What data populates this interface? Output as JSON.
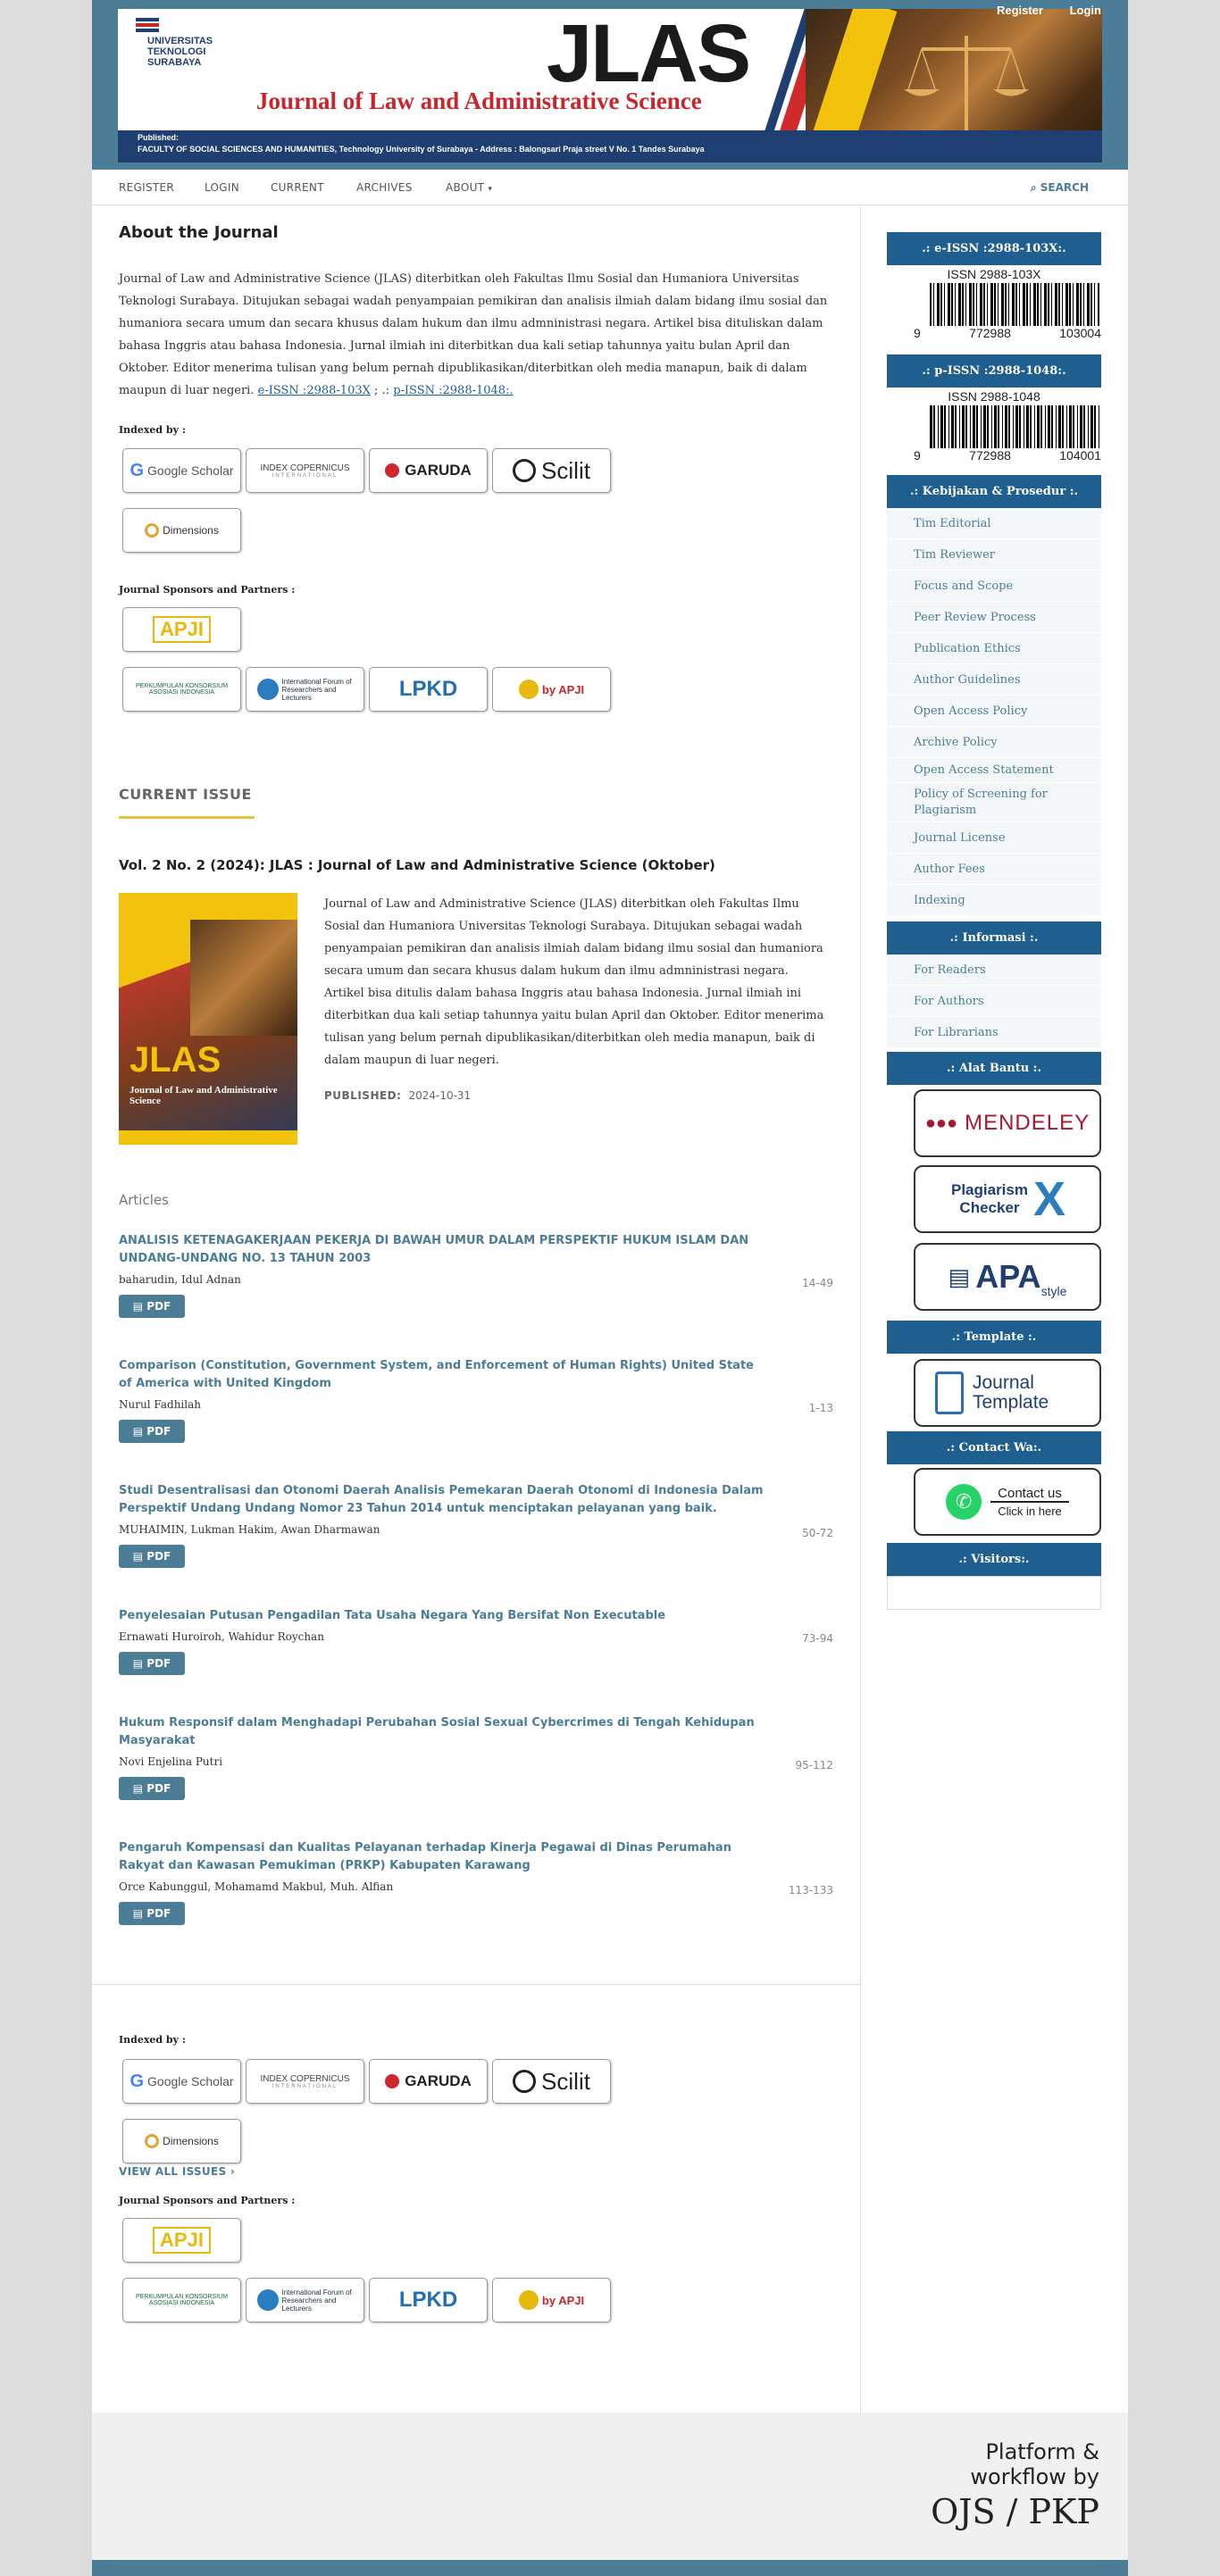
{
  "header": {
    "university": [
      "UNIVERSITAS",
      "TEKNOLOGI",
      "SURABAYA"
    ],
    "journal_short": "JLAS",
    "journal_full": "Journal of Law and Administrative Science",
    "published_label": "Published:",
    "published_detail": "FACULTY OF SOCIAL SCIENCES AND HUMANITIES, Technology University of Surabaya  -  Address : Balongsari Praja street V No. 1 Tandes Surabaya",
    "register": "Register",
    "login": "Login"
  },
  "nav": {
    "register": "REGISTER",
    "login": "LOGIN",
    "current": "CURRENT",
    "archives": "ARCHIVES",
    "about": "ABOUT",
    "about_caret": "▾",
    "search": "SEARCH"
  },
  "about": {
    "title": "About the Journal",
    "text": "Journal of Law and Administrative Science (JLAS) diterbitkan oleh Fakultas Ilmu Sosial dan Humaniora Universitas Teknologi Surabaya. Ditujukan sebagai wadah penyampaian pemikiran dan analisis ilmiah dalam bidang ilmu sosial dan humaniora secara umum dan secara khusus dalam hukum dan ilmu admninistrasi negara. Artikel bisa dituliskan dalam bahasa Inggris atau bahasa Indonesia. Jurnal ilmiah ini diterbitkan dua kali setiap tahunnya yaitu bulan April dan Oktober. Editor menerima tulisan yang belum pernah dipublikasikan/diterbitkan oleh media manapun, baik di dalam maupun di luar negeri.",
    "eissn_link": "e-ISSN :2988-103X",
    "separator": "; .:",
    "pissn_link": "p-ISSN :2988-1048:."
  },
  "indexed": {
    "label": "Indexed by :",
    "google": "Google Scholar",
    "copernicus": "INDEX COPERNICUS",
    "copernicus_sub": "INTERNATIONAL",
    "garuda": "GARUDA",
    "scilit": "Scilit",
    "dimensions": "Dimensions"
  },
  "sponsors": {
    "label": "Journal Sponsors and Partners :",
    "apji": "APJI",
    "perkumpulan": "PERKUMPULAN KONSORSIUM ASOSIASI INDONESIA",
    "ifrel": "International Forum of Researchers and Lecturers",
    "lpkd": "LPKD",
    "doi_apji": "by APJI"
  },
  "current": {
    "heading": "CURRENT ISSUE",
    "issue_title": "Vol. 2 No. 2 (2024): JLAS : Journal of Law and Administrative Science (Oktober)",
    "description": "Journal of Law and Administrative Science (JLAS) diterbitkan oleh Fakultas Ilmu Sosial dan Humaniora Universitas Teknologi Surabaya. Ditujukan sebagai wadah penyampaian pemikiran dan analisis ilmiah dalam bidang ilmu sosial dan humaniora secara umum dan secara khusus dalam hukum dan ilmu admninistrasi negara. Artikel bisa ditulis dalam bahasa Inggris atau bahasa Indonesia. Jurnal ilmiah ini diterbitkan dua kali setiap tahunnya yaitu bulan April dan Oktober. Editor menerima tulisan yang belum pernah dipublikasikan/diterbitkan oleh media manapun, baik di dalam maupun di luar negeri.",
    "published_label": "PUBLISHED:",
    "published_date": "2024-10-31",
    "cover_title": "JLAS",
    "cover_sub": "Journal of Law and Administrative Science",
    "articles_label": "Articles",
    "pdf": "PDF",
    "view_all": "VIEW ALL ISSUES"
  },
  "articles": [
    {
      "title": "ANALISIS KETENAGAKERJAAN PEKERJA DI BAWAH UMUR DALAM PERSPEKTIF HUKUM ISLAM DAN UNDANG-UNDANG NO. 13 TAHUN 2003",
      "authors": "baharudin, Idul Adnan",
      "pages": "14-49"
    },
    {
      "title": "Comparison (Constitution, Government System, and Enforcement of Human Rights) United State of America with United Kingdom",
      "authors": "Nurul Fadhilah",
      "pages": "1-13"
    },
    {
      "title": "Studi Desentralisasi dan Otonomi Daerah Analisis Pemekaran Daerah Otonomi di Indonesia Dalam Perspektif Undang Undang Nomor 23 Tahun 2014 untuk menciptakan pelayanan yang baik.",
      "authors": "MUHAIMIN, Lukman Hakim, Awan Dharmawan",
      "pages": "50-72"
    },
    {
      "title": "Penyelesaian Putusan Pengadilan Tata Usaha Negara Yang Bersifat Non Executable",
      "authors": "Ernawati Huroiroh, Wahidur Roychan",
      "pages": "73-94"
    },
    {
      "title": "Hukum Responsif dalam Menghadapi Perubahan Sosial Sexual Cybercrimes di Tengah Kehidupan Masyarakat",
      "authors": "Novi Enjelina Putri",
      "pages": "95-112"
    },
    {
      "title": "Pengaruh Kompensasi dan Kualitas Pelayanan terhadap Kinerja Pegawai di Dinas Perumahan Rakyat dan Kawasan Pemukiman (PRKP) Kabupaten Karawang",
      "authors": "Orce Kabunggul, Mohamamd Makbul, Muh. Alfian",
      "pages": "113-133"
    }
  ],
  "sidebar": {
    "eissn_head": ".: e-ISSN :2988-103X:.",
    "eissn_bar": "ISSN 2988-103X",
    "eissn_digits": [
      "9",
      "772988",
      "103004"
    ],
    "pissn_head": ".: p-ISSN :2988-1048:.",
    "pissn_bar": "ISSN 2988-1048",
    "pissn_digits": [
      "9",
      "772988",
      "104001"
    ],
    "policy_head": ".: Kebijakan & Prosedur :.",
    "policy_items": [
      "Tim Editorial",
      "Tim Reviewer",
      "Focus and Scope",
      "Peer Review Process",
      "Publication Ethics",
      "Author Guidelines",
      "Open Access Policy",
      "Archive Policy",
      "Open Access Statement",
      "Policy of Screening for Plagiarism",
      "Journal License",
      "Author Fees",
      "Indexing"
    ],
    "info_head": ".: Informasi :.",
    "info_items": [
      "For Readers",
      "For Authors",
      "For Librarians"
    ],
    "tools_head": ".: Alat Bantu :.",
    "mendeley": "MENDELEY",
    "plagiarism": "Plagiarism Checker",
    "apa": "APA",
    "apa_sub": "style",
    "template_head": ".: Template :.",
    "template": "Journal Template",
    "contact_head": ".: Contact Wa:.",
    "contact": "Contact us",
    "contact_sub": "Click in here",
    "visitors_head": ".: Visitors:."
  },
  "footer": {
    "line1": "Platform &",
    "line2": "workflow by",
    "line3": "OJS / PKP"
  },
  "colors": {
    "brand_teal": "#4b7d96",
    "sidebar_blue": "#1f5f8f",
    "accent_yellow": "#e8c13a",
    "banner_red": "#c9252b"
  }
}
